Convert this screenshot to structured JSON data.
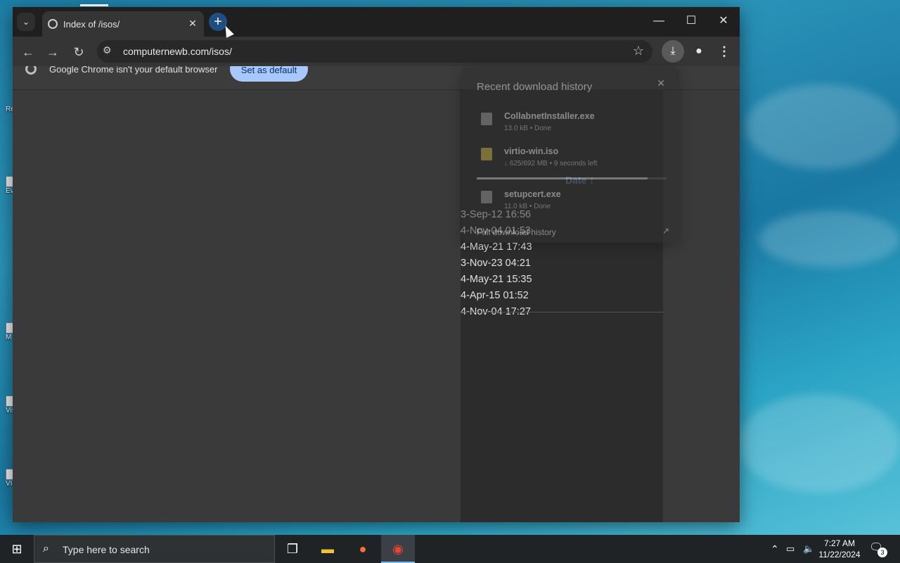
{
  "tab": {
    "title": "Index of /isos/",
    "close": "✕"
  },
  "toolbar": {
    "url": "computernewb.com/isos/"
  },
  "window_controls": {
    "minimize": "—",
    "maximize": "☐",
    "close": "✕"
  },
  "infobar": {
    "message": "Google Chrome isn't your default browser",
    "button": "Set as default"
  },
  "listing": {
    "date_header": "Date",
    "dates": [
      "3-Sep-12 16:56",
      "4-Nov-04 01:53",
      "4-May-21 17:43",
      "3-Nov-23 04:21",
      "4-May-21 15:35",
      "4-Apr-15 01:52",
      "4-Nov-04 17:27"
    ]
  },
  "downloads": {
    "title": "Recent download history",
    "items": [
      {
        "name": "CollabnetInstaller.exe",
        "status": "13.0 kB • Done"
      },
      {
        "name": "virtio-win.iso",
        "status": "↓ 625/692 MB • 9 seconds left"
      },
      {
        "name": "setupcert.exe",
        "status": "11.0 kB • Done"
      }
    ],
    "progress": 0.9,
    "full_history": "Full download history"
  },
  "taskbar": {
    "search_placeholder": "Type here to search",
    "time": "7:27 AM",
    "date": "11/22/2024",
    "notifications": "3"
  },
  "desktop": {
    "icon_labels": [
      "Re",
      "Ev",
      "M",
      "Vis",
      "VI"
    ]
  }
}
